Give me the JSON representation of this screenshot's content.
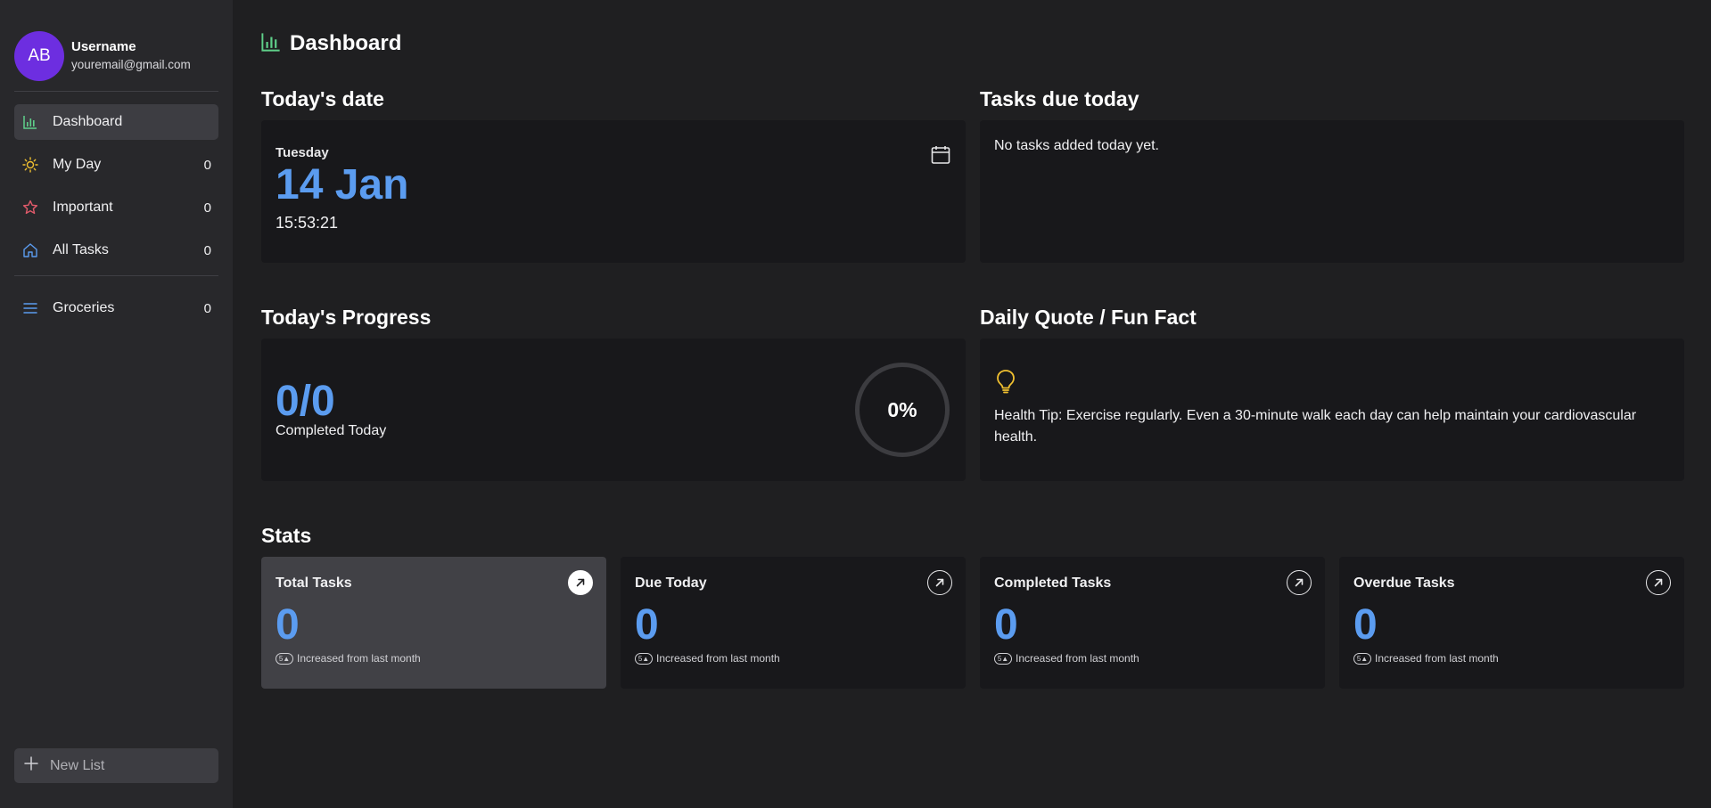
{
  "profile": {
    "initials": "AB",
    "name": "Username",
    "email": "youremail@gmail.com"
  },
  "nav": {
    "items": [
      {
        "label": "Dashboard",
        "icon": "chart-icon"
      },
      {
        "label": "My Day",
        "count": "0",
        "icon": "sun-icon"
      },
      {
        "label": "Important",
        "count": "0",
        "icon": "star-icon"
      },
      {
        "label": "All Tasks",
        "count": "0",
        "icon": "home-icon"
      }
    ],
    "lists": [
      {
        "label": "Groceries",
        "count": "0",
        "icon": "list-icon"
      }
    ],
    "new_list_label": "New List"
  },
  "header": {
    "title": "Dashboard"
  },
  "today": {
    "title": "Today's date",
    "day": "Tuesday",
    "date": "14 Jan",
    "time": "15:53:21"
  },
  "tasks_due": {
    "title": "Tasks due today",
    "empty_text": "No tasks added today yet."
  },
  "progress": {
    "title": "Today's Progress",
    "value": "0/0",
    "label": "Completed Today",
    "percent": "0%"
  },
  "quote": {
    "title": "Daily Quote / Fun Fact",
    "text": "Health Tip: Exercise regularly. Even a 30-minute walk each day can help maintain your cardiovascular health."
  },
  "stats": {
    "title": "Stats",
    "cards": [
      {
        "title": "Total Tasks",
        "value": "0",
        "badge": "5",
        "sub": "Increased from last month"
      },
      {
        "title": "Due Today",
        "value": "0",
        "badge": "5",
        "sub": "Increased from last month"
      },
      {
        "title": "Completed Tasks",
        "value": "0",
        "badge": "5",
        "sub": "Increased from last month"
      },
      {
        "title": "Overdue Tasks",
        "value": "0",
        "badge": "5",
        "sub": "Increased from last month"
      }
    ]
  },
  "colors": {
    "accent_blue": "#5b9cf0",
    "avatar_purple": "#6d2ee0",
    "sun_yellow": "#f0c030",
    "star_red": "#e05a6a",
    "chart_green": "#5fd08a"
  }
}
